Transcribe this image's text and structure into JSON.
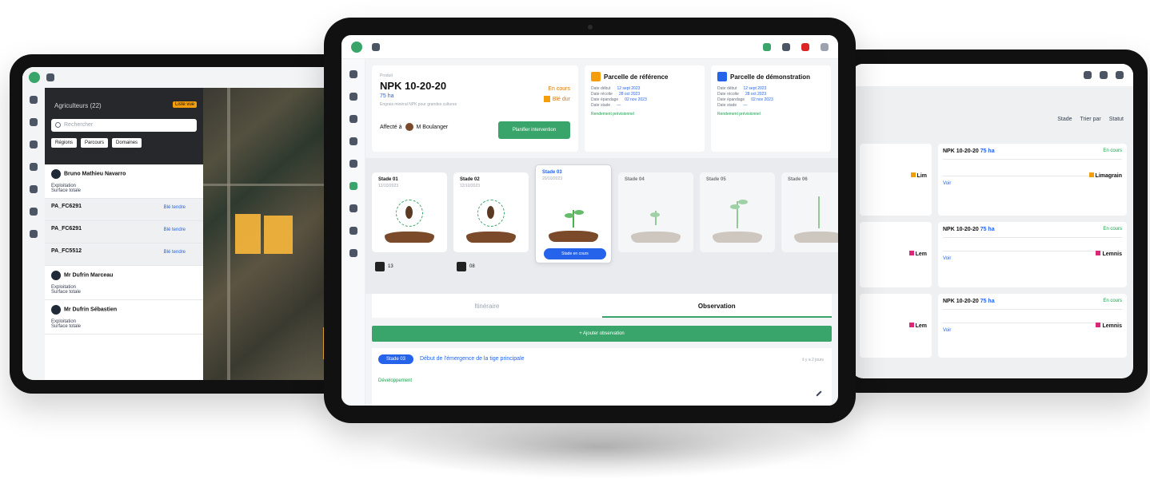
{
  "left": {
    "title": "Agriculteurs (22)",
    "badge": "Liste vue",
    "search_placeholder": "Rechercher",
    "filters": [
      "Régions",
      "Parcours",
      "Domaines"
    ],
    "items": [
      {
        "name": "Bruno Mathieu Navarro",
        "line1": "Exploitation",
        "line2": "Surface totale"
      },
      {
        "name": "PA_FC6291",
        "blue": "Blé tendre"
      },
      {
        "name": "PA_FC6291",
        "blue": "Blé tendre"
      },
      {
        "name": "PA_FC5512",
        "blue": "Blé tendre"
      },
      {
        "name": "Mr Dufrin Marceau",
        "line1": "Exploitation",
        "line2": "Surface totale"
      },
      {
        "name": "Mr Dufrin Sébastien",
        "line1": "Exploitation",
        "line2": "Surface totale"
      }
    ]
  },
  "center": {
    "product": {
      "tiny": "Produit",
      "name": "NPK 10-20-20",
      "qty": "75 ha",
      "desc": "Engrais minéral NPK pour grandes cultures",
      "status": "En cours",
      "bio": "Blé dur",
      "affect": "Affecté à",
      "person": "M Boulanger",
      "button": "Planifier intervention"
    },
    "plot_ref": {
      "title": "Parcelle de référence",
      "rows": [
        "Date début",
        "Date récolte",
        "Date épandage",
        "Date stade"
      ],
      "values": [
        "12 sept 2023",
        "28 oct 2023",
        "02 nov 2023",
        "—"
      ],
      "sub": "Rendement prévisionnel",
      "color": "#f59e0b"
    },
    "plot_demo": {
      "title": "Parcelle de démonstration",
      "rows": [
        "Date début",
        "Date récolte",
        "Date épandage",
        "Date stade"
      ],
      "values": [
        "12 sept 2023",
        "28 oct 2023",
        "02 nov 2023",
        "—"
      ],
      "sub": "Rendement prévisionnel",
      "color": "#2563eb"
    },
    "stages": [
      {
        "label": "Stade 01",
        "date": "12/10/2023"
      },
      {
        "label": "Stade 02",
        "date": "12/10/2023"
      },
      {
        "label": "Stade 03",
        "date": "20/10/2023",
        "button": "Stade en cours"
      },
      {
        "label": "Stade 04",
        "date": ""
      },
      {
        "label": "Stade 05",
        "date": ""
      },
      {
        "label": "Stade 06",
        "date": ""
      }
    ],
    "mini": [
      "13",
      "08"
    ],
    "tabs": [
      "Itinéraire",
      "Observation"
    ],
    "add_button": "+ Ajouter observation",
    "obs": {
      "pill": "Stade 03",
      "title": "Début de l'émergence de la tige principale",
      "ago": "il y a 2 jours",
      "label": "Développement"
    }
  },
  "right": {
    "filters": [
      "Stade",
      "Trier par",
      "Statut"
    ],
    "cards": [
      {
        "title": "NPK 10-20-20",
        "qty": "75 ha",
        "status": "En cours",
        "brand": "Limagrain",
        "link": "Voir"
      },
      {
        "title": "NPK 10-20-20",
        "qty": "75 ha",
        "status": "En cours",
        "brand": "Lemnis",
        "link": "Voir"
      },
      {
        "title": "NPK 10-20-20",
        "qty": "75 ha",
        "status": "En cours",
        "brand": "Lemnis",
        "link": "Voir"
      }
    ]
  },
  "colors": {
    "green": "#3aa56a",
    "blue": "#2563eb",
    "orange": "#f59e0b"
  }
}
